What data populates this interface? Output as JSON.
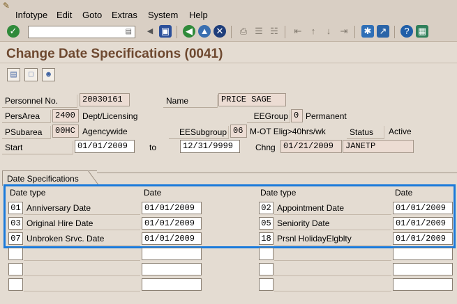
{
  "menu": {
    "items": [
      {
        "label": "Infotype",
        "underline": "I",
        "rest": "nfotype"
      },
      {
        "label": "Edit",
        "underline": "E",
        "rest": "dit"
      },
      {
        "label": "Goto",
        "underline": "G",
        "rest": "oto"
      },
      {
        "label": "Extras",
        "underline": "x",
        "prefix": "E",
        "rest": "tras"
      },
      {
        "label": "System",
        "underline": "y",
        "prefix": "S",
        "rest": "stem"
      },
      {
        "label": "Help",
        "underline": "H",
        "rest": "elp"
      }
    ]
  },
  "toolbar": {
    "command_value": "",
    "icons": [
      "enter-icon",
      "back-icon",
      "exit-icon",
      "cancel-icon",
      "save-icon",
      "print-icon",
      "find-icon",
      "find-next-icon",
      "first-page-icon",
      "previous-page-icon",
      "next-page-icon",
      "last-page-icon",
      "create-session-icon",
      "shortcut-icon",
      "help-icon",
      "layout-icon"
    ],
    "accent": "#1a7adb"
  },
  "title": "Change Date Specifications (0041)",
  "header": {
    "personnel_no_label": "Personnel No.",
    "personnel_no": "20030161",
    "name_label": "Name",
    "name": "PRICE SAGE",
    "persarea_label": "PersArea",
    "persarea": "2400",
    "persarea_text": "Dept/Licensing",
    "eegroup_label": "EEGroup",
    "eegroup": "0",
    "eegroup_text": "Permanent",
    "psubarea_label": "PSubarea",
    "psubarea": "00HC",
    "psubarea_text": "Agencywide",
    "eesubgroup_label": "EESubgroup",
    "eesubgroup": "06",
    "eesubgroup_text": "M-OT Elig>40hrs/wk",
    "status_label": "Status",
    "status": "Active",
    "start_label": "Start",
    "start": "01/01/2009",
    "to_label": "to",
    "end": "12/31/9999",
    "chng_label": "Chng",
    "chng_date": "01/21/2009",
    "chng_user": "JANETP"
  },
  "date_specs": {
    "group_title": "Date Specifications",
    "col_type": "Date type",
    "col_date": "Date",
    "left": [
      {
        "code": "01",
        "label": "Anniversary Date",
        "date": "01/01/2009"
      },
      {
        "code": "03",
        "label": "Original Hire Date",
        "date": "01/01/2009"
      },
      {
        "code": "07",
        "label": "Unbroken Srvc. Date",
        "date": "01/01/2009"
      },
      {
        "code": "",
        "label": "",
        "date": ""
      },
      {
        "code": "",
        "label": "",
        "date": ""
      },
      {
        "code": "",
        "label": "",
        "date": ""
      }
    ],
    "right": [
      {
        "code": "02",
        "label": "Appointment Date",
        "date": "01/01/2009"
      },
      {
        "code": "05",
        "label": "Seniority Date",
        "date": "01/01/2009"
      },
      {
        "code": "18",
        "label": "Prsnl HolidayElgblty",
        "date": "01/01/2009"
      },
      {
        "code": "",
        "label": "",
        "date": ""
      },
      {
        "code": "",
        "label": "",
        "date": ""
      },
      {
        "code": "",
        "label": "",
        "date": ""
      }
    ]
  }
}
